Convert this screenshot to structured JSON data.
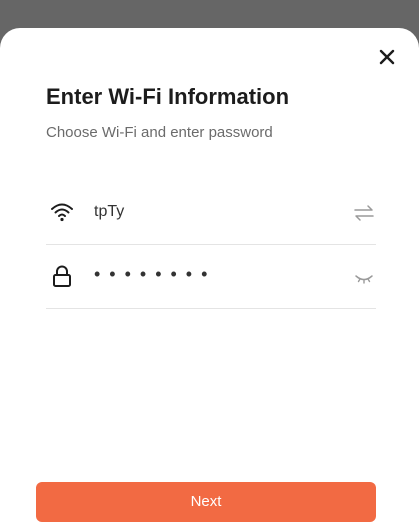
{
  "dialog": {
    "title": "Enter Wi-Fi Information",
    "subtitle": "Choose Wi-Fi and enter password"
  },
  "ssid_field": {
    "value": "tpTy",
    "icon": "wifi-icon",
    "action_icon": "swap-arrows-icon"
  },
  "password_field": {
    "masked_value": "••••••••",
    "icon": "lock-icon",
    "action_icon": "eye-closed-icon"
  },
  "actions": {
    "next_label": "Next",
    "close_icon": "close-icon"
  },
  "colors": {
    "accent": "#f26a43",
    "backdrop": "#666666",
    "sheet": "#ffffff"
  }
}
